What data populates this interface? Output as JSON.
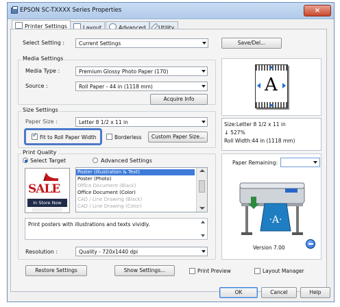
{
  "window": {
    "title": "EPSON SC-TXXXX Series Properties",
    "close_glyph": "×"
  },
  "tabs": [
    {
      "label": "Printer Settings"
    },
    {
      "label": "Layout"
    },
    {
      "label": "Advanced"
    },
    {
      "label": "Utility"
    }
  ],
  "select_setting": {
    "label": "Select Setting :",
    "value": "Current Settings",
    "save_button": "Save/Del..."
  },
  "media_settings": {
    "title": "Media Settings",
    "media_type_label": "Media Type :",
    "media_type_value": "Premium Glossy Photo Paper (170)",
    "source_label": "Source :",
    "source_value": "Roll Paper - 44 in (1118 mm)",
    "acquire_button": "Acquire Info"
  },
  "size_settings": {
    "title": "Size Settings",
    "paper_size_label": "Paper Size :",
    "paper_size_value": "Letter 8 1/2 x 11 in",
    "fit_roll_label": "Fit to Roll Paper Width",
    "fit_roll_checked": true,
    "borderless_label": "Borderless",
    "custom_button": "Custom Paper Size..."
  },
  "size_info": {
    "line1": "Size:Letter 8 1/2 x 11 in",
    "line2": "527%",
    "line3": "Roll Width:44 in (1118 mm)"
  },
  "print_quality": {
    "title": "Print Quality",
    "select_target_label": "Select Target",
    "advanced_label": "Advanced Settings",
    "targets": [
      {
        "label": "Poster (Illustration & Text)",
        "state": "selected"
      },
      {
        "label": "Poster (Photo)",
        "state": "normal"
      },
      {
        "label": "Office Document (Black)",
        "state": "disabled"
      },
      {
        "label": "Office Document (Color)",
        "state": "normal"
      },
      {
        "label": "CAD / Line Drawing (Black)",
        "state": "disabled"
      },
      {
        "label": "CAD / Line Drawing (Color)",
        "state": "disabled"
      }
    ],
    "sale_text": "SALE",
    "store_text": "In Store Now",
    "description": "Print posters with illustrations and texts vividly.",
    "resolution_label": "Resolution :",
    "resolution_value": "Quality - 720x1440 dpi"
  },
  "preview": {
    "letter": "A",
    "paper_remaining_label": "Paper Remaining:",
    "version": "Version 7.00"
  },
  "bottom": {
    "restore_button": "Restore Settings",
    "show_settings_button": "Show Settings...",
    "print_preview_label": "Print Preview",
    "layout_manager_label": "Layout Manager",
    "ok_button": "OK",
    "cancel_button": "Cancel",
    "help_button": "Help"
  },
  "colors": {
    "accent": "#4a78c8",
    "selection": "#3e7bd8",
    "close": "#c8482e"
  }
}
